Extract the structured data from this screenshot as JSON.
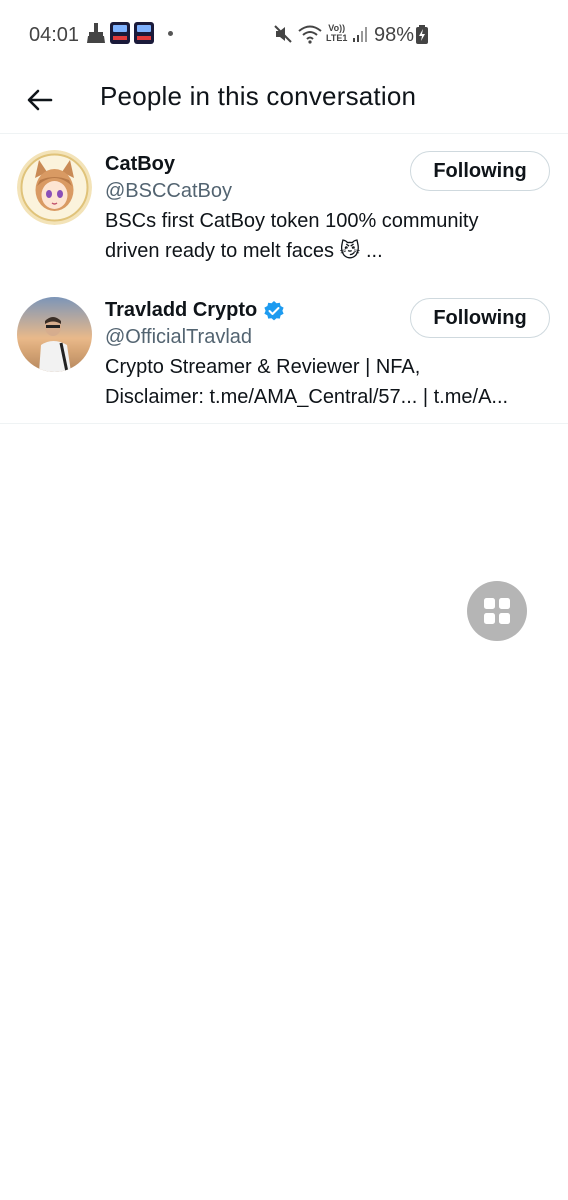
{
  "status_bar": {
    "time": "04:01",
    "battery": "98%",
    "network": "LTE1"
  },
  "header": {
    "title": "People in this conversation"
  },
  "users": [
    {
      "name": "CatBoy",
      "handle": "@BSCCatBoy",
      "bio": "BSCs first CatBoy token 100% community\ndriven ready to melt faces 😼 ...",
      "follow_label": "Following",
      "verified": false
    },
    {
      "name": "Travladd Crypto",
      "handle": "@OfficialTravlad",
      "bio": "Crypto Streamer & Reviewer | NFA,\nDisclaimer: t.me/AMA_Central/57... | t.me/A...",
      "follow_label": "Following",
      "verified": true
    }
  ],
  "colors": {
    "text_primary": "#0f1419",
    "text_secondary": "#536471",
    "verified_blue": "#1d9bf0",
    "border": "#cfd9de"
  }
}
